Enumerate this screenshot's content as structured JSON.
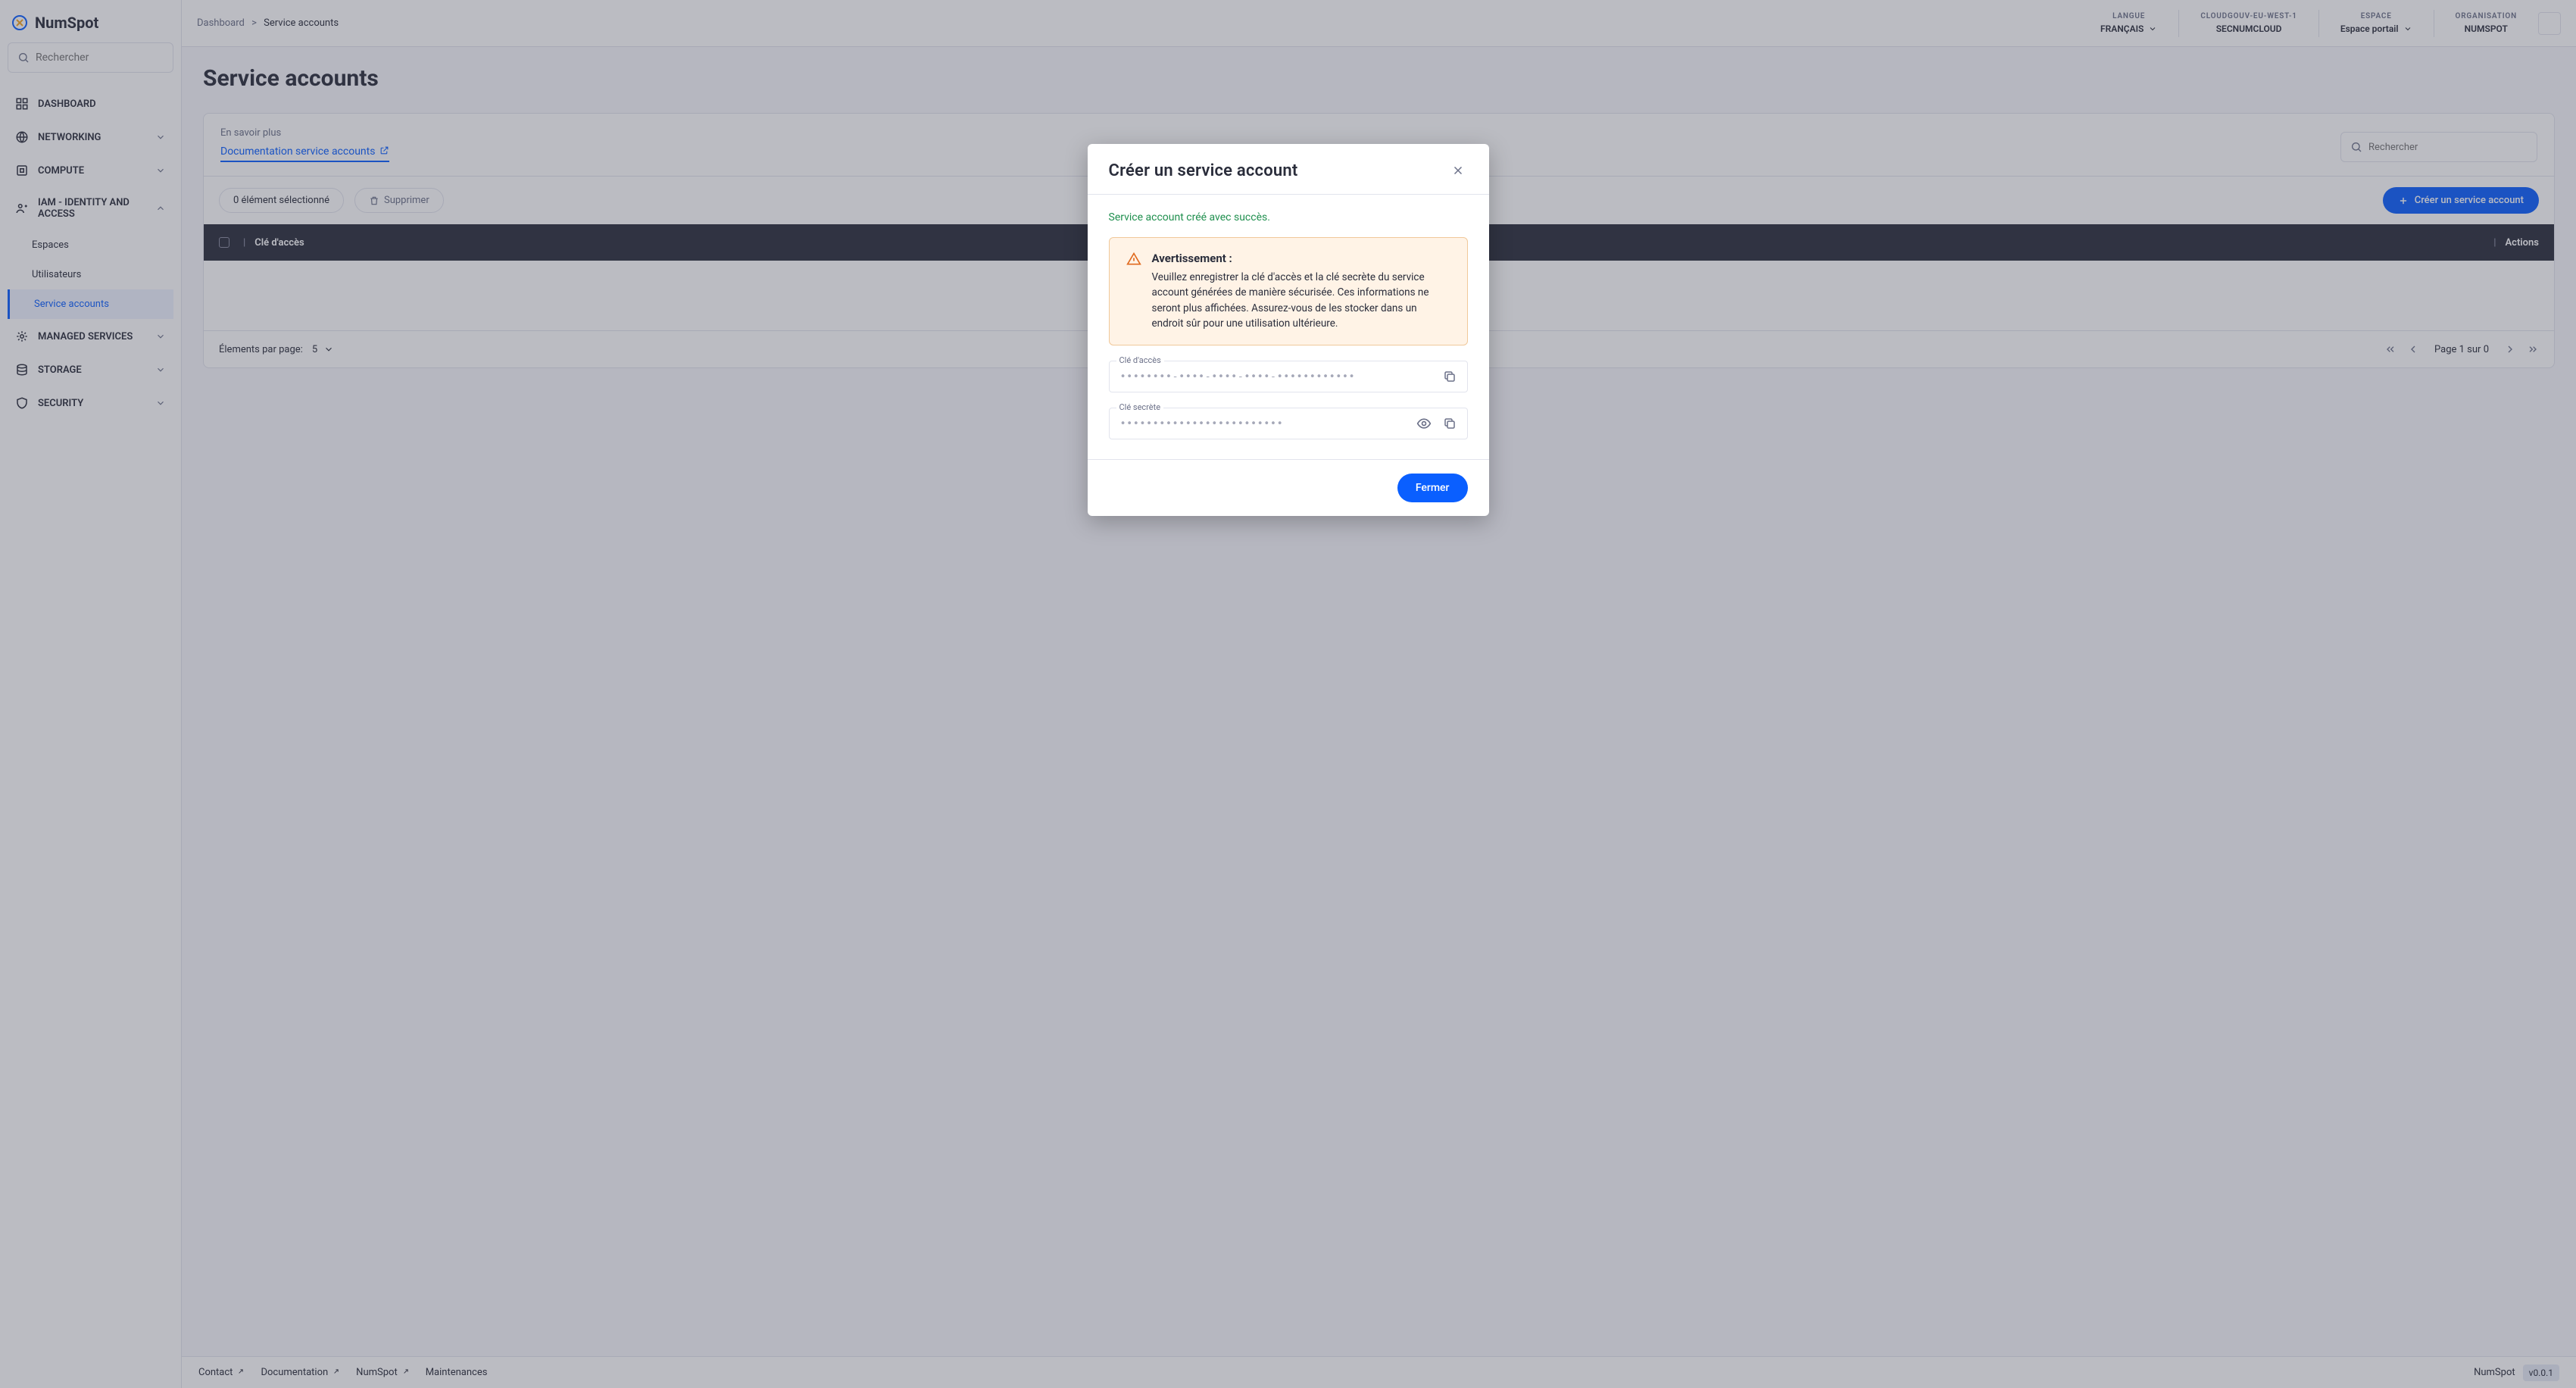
{
  "brand": "NumSpot",
  "sidebar": {
    "search_placeholder": "Rechercher",
    "items": [
      {
        "label": "DASHBOARD",
        "icon": "dashboard-icon",
        "expandable": false
      },
      {
        "label": "NETWORKING",
        "icon": "network-icon",
        "expandable": true
      },
      {
        "label": "COMPUTE",
        "icon": "compute-icon",
        "expandable": true
      },
      {
        "label": "IAM - IDENTITY AND ACCESS",
        "icon": "iam-icon",
        "expandable": true,
        "expanded": true,
        "children": [
          {
            "label": "Espaces"
          },
          {
            "label": "Utilisateurs"
          },
          {
            "label": "Service accounts",
            "active": true
          }
        ]
      },
      {
        "label": "MANAGED SERVICES",
        "icon": "managed-icon",
        "expandable": true
      },
      {
        "label": "STORAGE",
        "icon": "storage-icon",
        "expandable": true
      },
      {
        "label": "SECURITY",
        "icon": "security-icon",
        "expandable": true
      }
    ]
  },
  "header": {
    "breadcrumb": {
      "root": "Dashboard",
      "sep": ">",
      "current": "Service accounts"
    },
    "lang": {
      "label": "LANGUE",
      "value": "FRANÇAIS"
    },
    "region": {
      "label": "CLOUDGOUV-EU-WEST-1",
      "value": "SECNUMCLOUD"
    },
    "space": {
      "label": "ESPACE",
      "value": "Espace portail"
    },
    "org": {
      "label": "ORGANISATION",
      "value": "NUMSPOT"
    }
  },
  "page": {
    "title": "Service accounts",
    "learn_more": "En savoir plus",
    "doc_link": "Documentation service accounts",
    "table_search_placeholder": "Rechercher",
    "selection": "0 élément sélectionné",
    "delete_label": "Supprimer",
    "create_label": "Créer un service account",
    "col_key": "Clé d'accès",
    "col_actions": "Actions",
    "per_page_label": "Élements par page:",
    "per_page_value": "5",
    "page_text": "Page 1 sur 0"
  },
  "footer": {
    "contact": "Contact",
    "docs": "Documentation",
    "nums": "NumSpot",
    "maint": "Maintenances",
    "brand": "NumSpot",
    "version": "v0.0.1"
  },
  "modal": {
    "title": "Créer un service account",
    "success": "Service account créé avec succès.",
    "warn_title": "Avertissement :",
    "warn_body": "Veuillez enregistrer la clé d'accès et la clé secrète du service account générées de manière sécurisée. Ces informations ne seront plus affichées. Assurez-vous de les stocker dans un endroit sûr pour une utilisation ultérieure.",
    "field_access_label": "Clé d'accès",
    "field_access_value": "••••••••-••••-••••-••••-••••••••••••",
    "field_secret_label": "Clé secrète",
    "field_secret_value": "•••••••••••••••••••••••••",
    "close_label": "Fermer"
  }
}
